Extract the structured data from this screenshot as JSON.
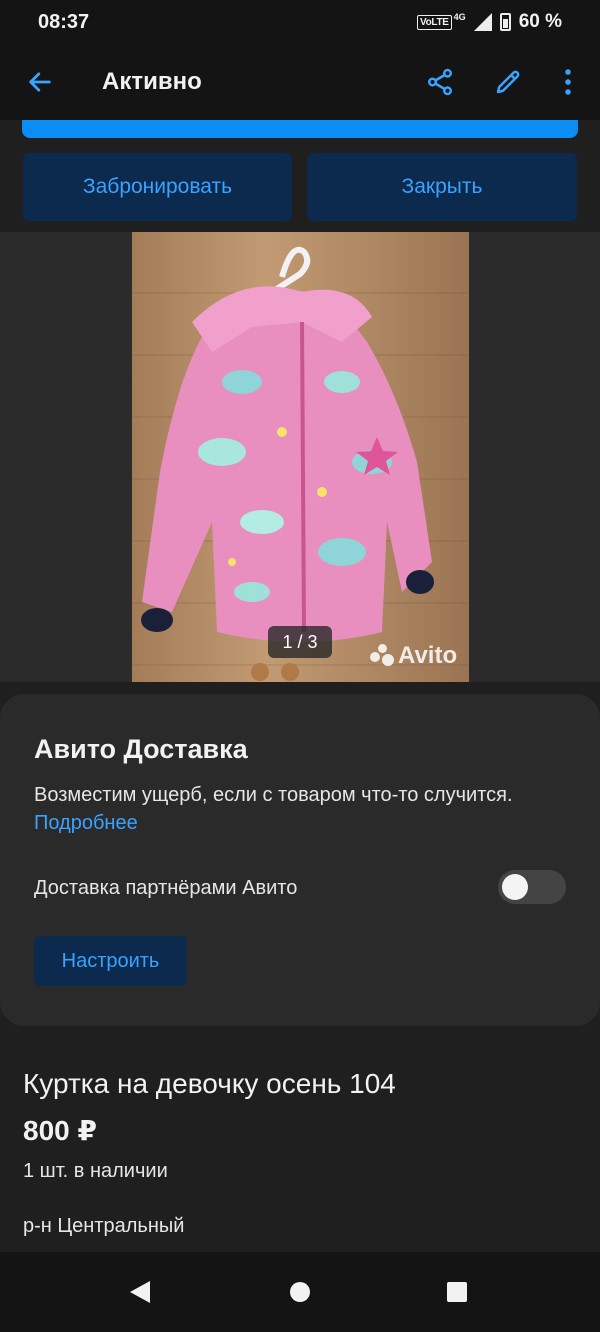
{
  "status_bar": {
    "time": "08:37",
    "network_badge": "VoLTE",
    "network_type": "4G",
    "battery": "60 %"
  },
  "app_bar": {
    "title": "Активно",
    "icons": [
      "arrow-left-icon",
      "share-icon",
      "edit-icon",
      "more-vert-icon"
    ]
  },
  "actions": {
    "reserve_label": "Забронировать",
    "close_label": "Закрыть"
  },
  "gallery": {
    "pager": "1 / 3",
    "watermark": "Avito"
  },
  "delivery": {
    "title": "Авито Доставка",
    "description": "Возместим ущерб, если с товаром что-то случится.",
    "more_link": "Подробнее",
    "toggle_label": "Доставка партнёрами Авито",
    "toggle_on": false,
    "setup_label": "Настроить"
  },
  "item": {
    "title": "Куртка на девочку осень 104",
    "price": "800 ₽",
    "stock": "1 шт. в наличии",
    "location": "р-н Центральный"
  },
  "colors": {
    "accent": "#0a8ef5",
    "link": "#3aa2ff",
    "button_bg": "#0b2a4d",
    "background": "#1f1f1f",
    "card": "#2a2a2a"
  }
}
